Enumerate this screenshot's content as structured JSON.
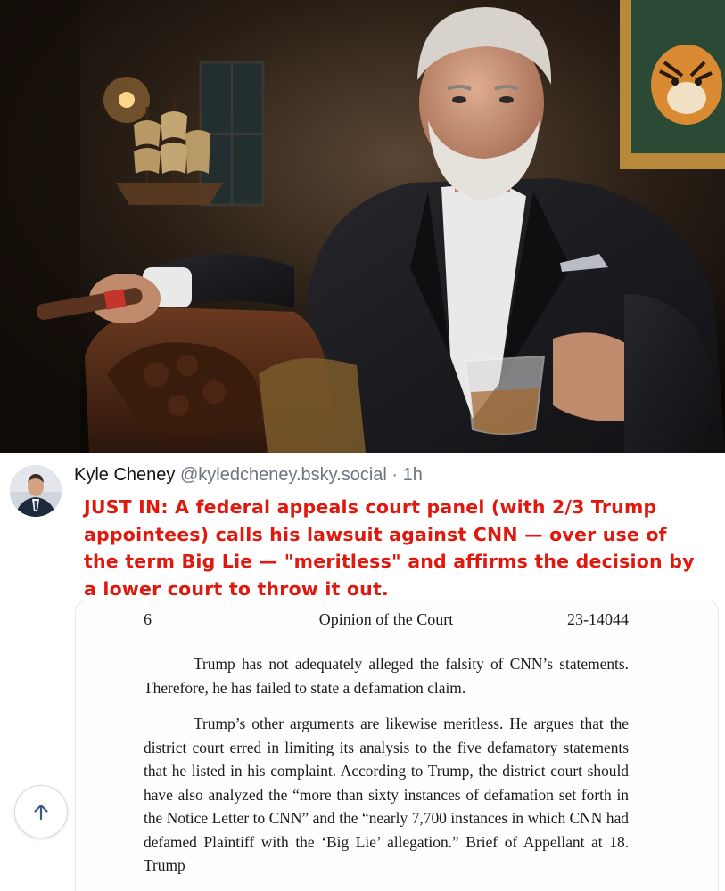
{
  "photo": {
    "alt": "",
    "accent_colors": {
      "background": "#1a130d",
      "suit": "#1b1b1f",
      "shirt": "#e9e9ea",
      "skin": "#c89478",
      "hair": "#d7d3cc",
      "frame_gold": "#b8893a"
    }
  },
  "post": {
    "author": {
      "display_name": "Kyle Cheney",
      "handle": "@kyledcheney.bsky.social",
      "separator": "·",
      "time": "1h"
    },
    "text_color": "#e0190f",
    "text": "JUST IN: A federal appeals court panel (with 2/3 Trump appointees) calls his lawsuit against CNN — over use of the term Big Lie — \"meritless\" and affirms the decision by a lower court to throw it out."
  },
  "document": {
    "page_number": "6",
    "title": "Opinion of the Court",
    "case_number": "23-14044",
    "paragraphs": [
      "Trump has not adequately alleged the falsity of CNN’s statements. Therefore, he has failed to state a defamation claim.",
      "Trump’s other arguments are likewise meritless. He argues that the district court erred in limiting its analysis to the five defamatory statements that he listed in his complaint. According to Trump, the district court should have also analyzed the “more than sixty instances of defamation set forth in the Notice Letter to CNN” and the “nearly 7,700 instances in which CNN had defamed Plaintiff with the ‘Big Lie’ allegation.” Brief of Appellant at 18. Trump"
    ]
  },
  "icons": {
    "scroll_top": "arrow-up-icon",
    "avatar": "avatar"
  }
}
